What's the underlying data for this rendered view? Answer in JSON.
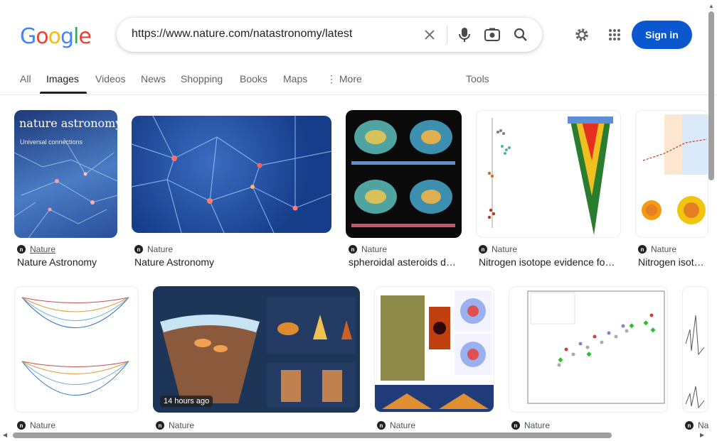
{
  "logo": {
    "letters": [
      "G",
      "o",
      "o",
      "g",
      "l",
      "e"
    ],
    "colors": [
      "#4285f4",
      "#ea4335",
      "#fbbc05",
      "#4285f4",
      "#34a853",
      "#ea4335"
    ]
  },
  "search": {
    "query": "https://www.nature.com/natastronomy/latest"
  },
  "header": {
    "sign_in": "Sign in",
    "accent": "#0b57d0"
  },
  "tabs": {
    "all": "All",
    "images": "Images",
    "videos": "Videos",
    "news": "News",
    "shopping": "Shopping",
    "books": "Books",
    "maps": "Maps",
    "more": "More",
    "tools": "Tools"
  },
  "results_row1": [
    {
      "source": "Nature",
      "title": "Nature Astronomy",
      "cover_title": "nature astronomy",
      "cover_subtitle": "Universal connections"
    },
    {
      "source": "Nature",
      "title": "Nature Astronomy"
    },
    {
      "source": "Nature",
      "title": "spheroidal asteroids d…"
    },
    {
      "source": "Nature",
      "title": "Nitrogen isotope evidence fo…"
    },
    {
      "source": "Nature",
      "title": "Nitrogen isotop…"
    }
  ],
  "results_row2": [
    {
      "source": "Nature"
    },
    {
      "source": "Nature",
      "badge": "14 hours ago"
    },
    {
      "source": "Nature"
    },
    {
      "source": "Nature"
    },
    {
      "source": "Na"
    }
  ]
}
